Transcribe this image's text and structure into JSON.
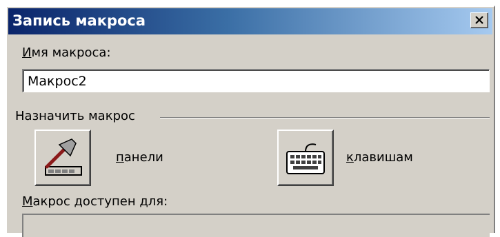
{
  "window": {
    "title": "Запись макроса",
    "close_glyph": "×"
  },
  "macro_name": {
    "label_accel": "И",
    "label_rest": "мя макроса:",
    "value": "Макрос2"
  },
  "assign": {
    "group_label": "Назначить макрос",
    "toolbar_button": {
      "icon": "hammer-toolbar-icon",
      "label_accel": "п",
      "label_rest": "анели"
    },
    "keyboard_button": {
      "icon": "keyboard-icon",
      "label_accel": "к",
      "label_rest": "лавишам"
    }
  },
  "available_for": {
    "label_accel": "М",
    "label_rest": "акрос доступен для:"
  },
  "colors": {
    "face": "#d4d0c8",
    "title_start": "#0a246a",
    "title_end": "#a6caf0"
  }
}
